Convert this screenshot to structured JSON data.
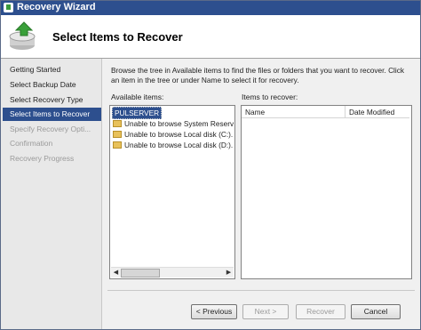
{
  "window": {
    "title": "Recovery Wizard"
  },
  "header": {
    "title": "Select Items to Recover",
    "icon": "backup-restore-icon"
  },
  "nav": {
    "items": [
      {
        "label": "Getting Started",
        "state": "normal"
      },
      {
        "label": "Select Backup Date",
        "state": "normal"
      },
      {
        "label": "Select Recovery Type",
        "state": "normal"
      },
      {
        "label": "Select Items to Recover",
        "state": "selected"
      },
      {
        "label": "Specify Recovery Opti...",
        "state": "disabled"
      },
      {
        "label": "Confirmation",
        "state": "disabled"
      },
      {
        "label": "Recovery Progress",
        "state": "disabled"
      }
    ]
  },
  "main": {
    "instructions": "Browse the tree in Available items to find the files or folders that you want to recover. Click an item in the tree or under Name to select it for recovery.",
    "available_label": "Available items:",
    "recover_label": "Items to recover:",
    "tree": {
      "root": "PULSERVER",
      "children": [
        "Unable to browse System Reserved",
        "Unable to browse Local disk (C:). T",
        "Unable to browse Local disk (D:). T"
      ]
    },
    "columns": [
      "Name",
      "Date Modified"
    ]
  },
  "buttons": {
    "previous": "< Previous",
    "next": "Next >",
    "recover": "Recover",
    "cancel": "Cancel"
  },
  "colors": {
    "selection": "#2d4f8e",
    "titlebar": "#2d4f8e",
    "folder": "#e8c15a"
  }
}
